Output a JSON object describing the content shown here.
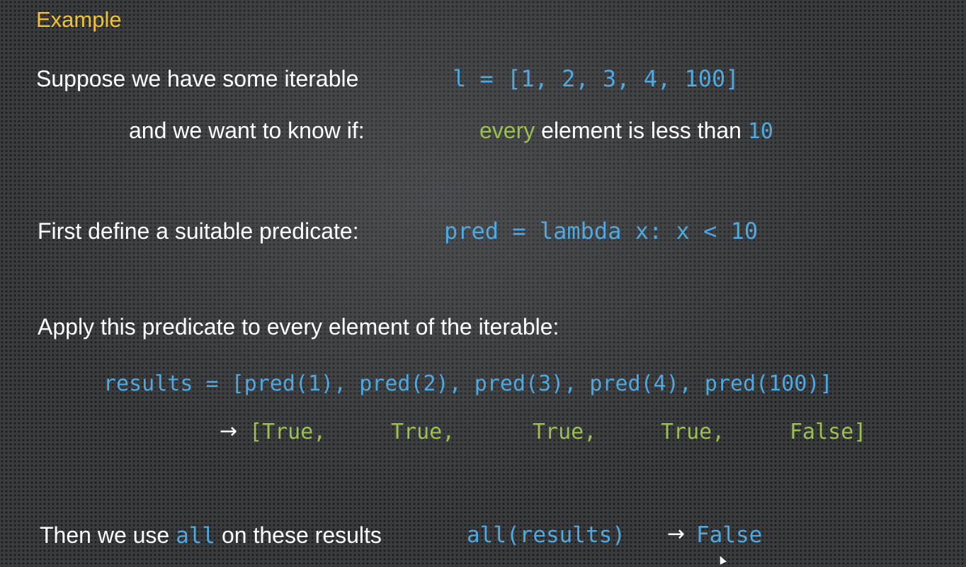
{
  "slide": {
    "title": "Example",
    "line1": {
      "text": "Suppose we have some iterable",
      "code": "l = [1, 2, 3, 4, 100]"
    },
    "line2": {
      "text": "and we want to know if:",
      "keyword": "every",
      "middle": " element is less than ",
      "value": "10"
    },
    "line3": {
      "text": "First define a suitable predicate:",
      "code": "pred = lambda x: x < 10"
    },
    "line4": {
      "text": "Apply this predicate to every element of the iterable:"
    },
    "results_code": "results = [pred(1), pred(2), pred(3), pred(4), pred(100)]",
    "results_values": {
      "arrow": "→",
      "v1": "[True,",
      "v2": "True,",
      "v3": "True,",
      "v4": "True,",
      "v5": "False]"
    },
    "line5": {
      "pre": "Then we use ",
      "keyword": "all",
      "post": " on these results",
      "code": "all(results)",
      "arrow": "→",
      "result": "False"
    }
  },
  "colors": {
    "title": "#f2c035",
    "code_blue": "#4fa8e0",
    "code_green": "#9cbf53",
    "text": "#ffffff",
    "background": "#3a3b3d"
  }
}
